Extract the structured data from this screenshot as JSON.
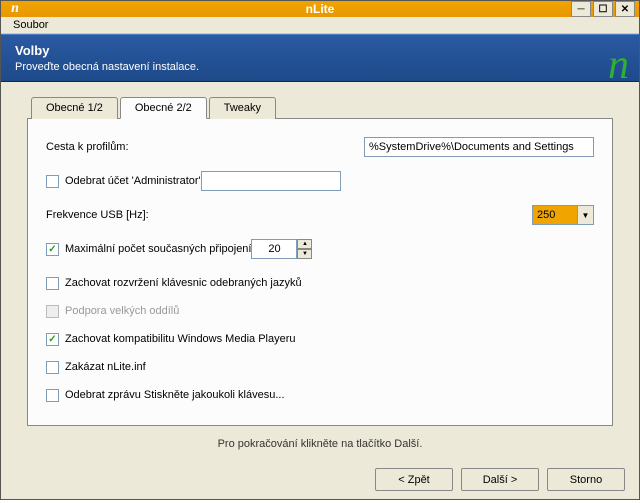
{
  "window": {
    "title": "nLite"
  },
  "menu": {
    "file": "Soubor"
  },
  "header": {
    "title": "Volby",
    "subtitle": "Proveďte obecná nastavení instalace."
  },
  "tabs": {
    "general1": "Obecné 1/2",
    "general2": "Obecné 2/2",
    "tweaks": "Tweaky"
  },
  "fields": {
    "profile_path_label": "Cesta k profilům:",
    "profile_path_value": "%SystemDrive%\\Documents and Settings",
    "remove_admin_label": "Odebrat účet 'Administrator'",
    "remove_admin_value": "",
    "usb_freq_label": "Frekvence USB [Hz]:",
    "usb_freq_value": "250",
    "max_conn_label": "Maximální počet současných připojení",
    "max_conn_value": "20",
    "keep_kb_label": "Zachovat rozvržení klávesnic odebraných jazyků",
    "large_part_label": "Podpora velkých oddílů",
    "wmp_compat_label": "Zachovat kompatibilitu Windows Media Playeru",
    "disable_nlite_inf_label": "Zakázat nLite.inf",
    "remove_press_key_label": "Odebrat zprávu Stiskněte jakoukoli klávesu..."
  },
  "checkboxes": {
    "remove_admin": false,
    "max_conn": true,
    "keep_kb": false,
    "large_part": false,
    "wmp_compat": true,
    "disable_nlite_inf": false,
    "remove_press_key": false
  },
  "footer": {
    "hint": "Pro pokračování klikněte na tlačítko Další."
  },
  "buttons": {
    "back": "< Zpět",
    "next": "Další >",
    "cancel": "Storno"
  }
}
